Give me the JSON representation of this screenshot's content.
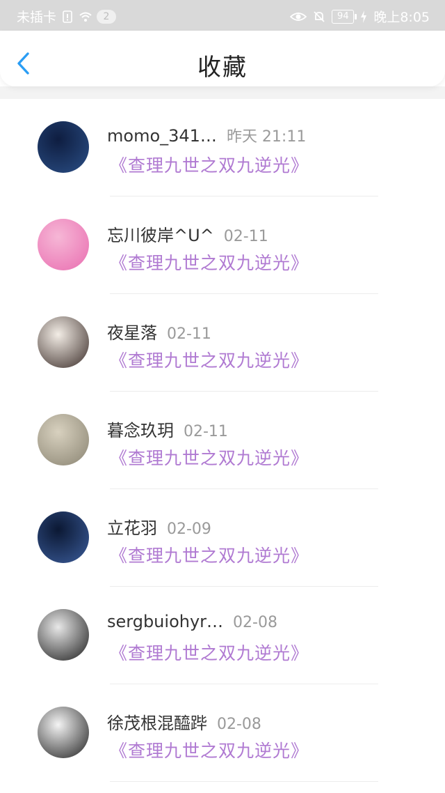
{
  "status_bar": {
    "carrier": "未插卡",
    "notif_count": "2",
    "battery": "94",
    "time": "晚上8:05"
  },
  "header": {
    "title": "收藏"
  },
  "favorites": [
    {
      "user": "momo_341…",
      "time": "昨天 21:11",
      "book": "《查理九世之双九逆光》",
      "avatar_colors": [
        "#0e1d40",
        "#2b4f86"
      ]
    },
    {
      "user": "忘川彼岸^U^",
      "time": "02-11",
      "book": "《查理九世之双九逆光》",
      "avatar_colors": [
        "#f6b7d6",
        "#e96db0"
      ]
    },
    {
      "user": "夜星落",
      "time": "02-11",
      "book": "《查理九世之双九逆光》",
      "avatar_colors": [
        "#f3ede6",
        "#3a2c28"
      ]
    },
    {
      "user": "暮念玖玥",
      "time": "02-11",
      "book": "《查理九世之双九逆光》",
      "avatar_colors": [
        "#d8d1bf",
        "#8a8472"
      ]
    },
    {
      "user": "立花羽",
      "time": "02-09",
      "book": "《查理九世之双九逆光》",
      "avatar_colors": [
        "#0b1833",
        "#3b5c9a"
      ]
    },
    {
      "user": "sergbuiohyr…",
      "time": "02-08",
      "book": "《查理九世之双九逆光》",
      "avatar_colors": [
        "#e8e8e8",
        "#1c1c1c"
      ]
    },
    {
      "user": "徐茂根混醯跸",
      "time": "02-08",
      "book": "《查理九世之双九逆光》",
      "avatar_colors": [
        "#f4f4f4",
        "#202020"
      ]
    }
  ]
}
